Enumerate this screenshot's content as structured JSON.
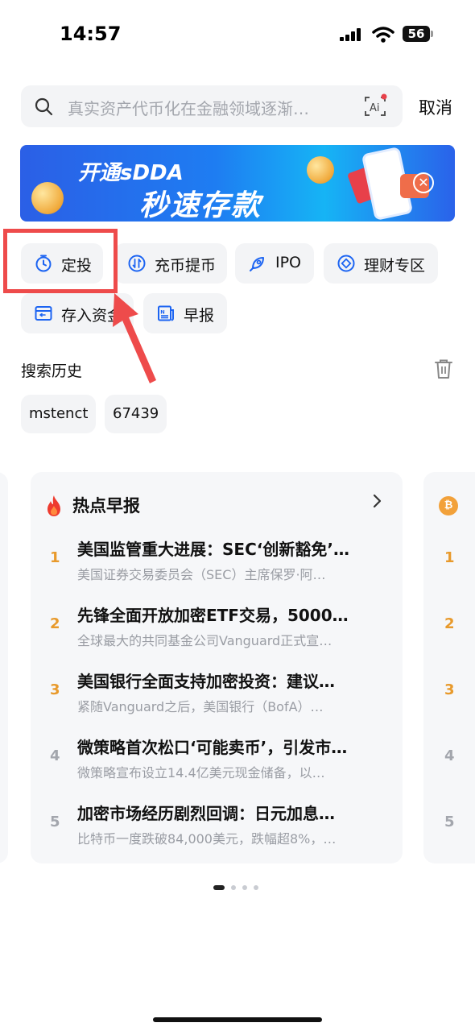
{
  "status_bar": {
    "time": "14:57",
    "battery": "56"
  },
  "search": {
    "placeholder": "真实资产代币化在金融领域逐渐…",
    "cancel_label": "取消"
  },
  "banner": {
    "line1": "开通sDDA",
    "line2": "秒速存款"
  },
  "quick_actions": [
    {
      "label": "定投",
      "icon": "timer-icon"
    },
    {
      "label": "充币提币",
      "icon": "transfer-icon"
    },
    {
      "label": "IPO",
      "icon": "rocket-icon"
    },
    {
      "label": "理财专区",
      "icon": "diamond-icon"
    },
    {
      "label": "存入资金",
      "icon": "deposit-card-icon"
    },
    {
      "label": "早报",
      "icon": "newspaper-icon"
    }
  ],
  "history": {
    "title": "搜索历史",
    "items": [
      "mstenct",
      "67439"
    ]
  },
  "hot_news": {
    "title": "热点早报",
    "items": [
      {
        "rank": "1",
        "title": "美国监管重大进展：SEC‘创新豁免’…",
        "summary": "美国证券交易委员会（SEC）主席保罗·阿…"
      },
      {
        "rank": "2",
        "title": "先锋全面开放加密ETF交易，5000…",
        "summary": "全球最大的共同基金公司Vanguard正式宣…"
      },
      {
        "rank": "3",
        "title": "美国银行全面支持加密投资：建议…",
        "summary": "紧随Vanguard之后，美国银行（BofA）…"
      },
      {
        "rank": "4",
        "title": "微策略首次松口‘可能卖币’，引发市…",
        "summary": "微策略宣布设立14.4亿美元现金储备，以…"
      },
      {
        "rank": "5",
        "title": "加密市场经历剧烈回调：日元加息…",
        "summary": "比特币一度跌破84,000美元，跌幅超8%，…"
      }
    ]
  },
  "side_card_ranks": [
    "1",
    "2",
    "3",
    "4",
    "5"
  ],
  "pager": {
    "pages": 4,
    "active": 1
  },
  "colors": {
    "rank_top": "#e89a2c",
    "rank_other": "#a3a6ad",
    "accent_blue": "#1c64f2",
    "highlight_red": "#ee4b4b"
  }
}
